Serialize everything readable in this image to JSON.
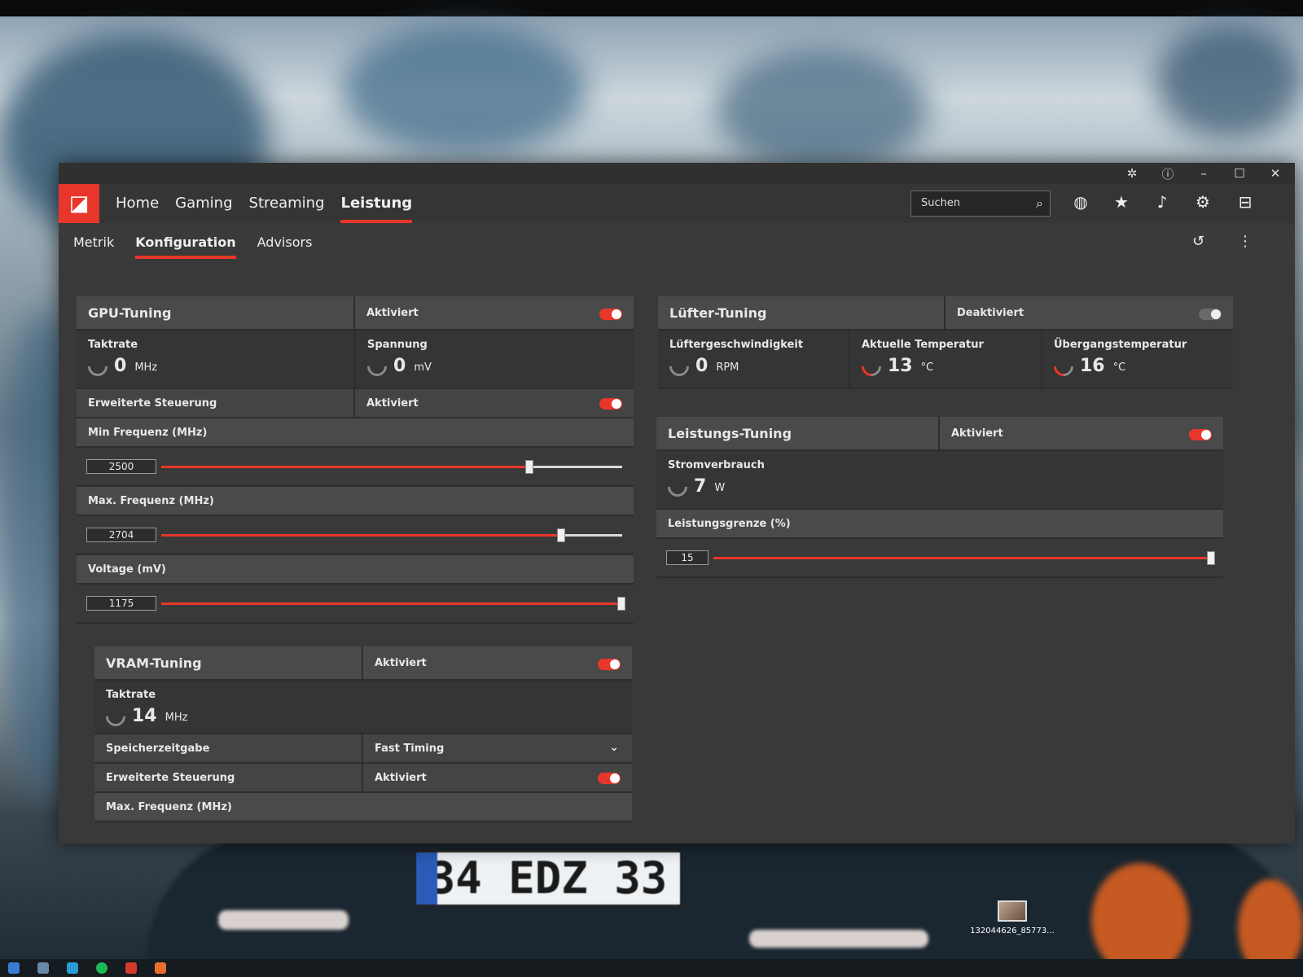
{
  "window": {
    "nav": [
      "Home",
      "Gaming",
      "Streaming",
      "Leistung"
    ],
    "active_nav": "Leistung",
    "search_placeholder": "Suchen",
    "subnav": [
      "Metrik",
      "Konfiguration",
      "Advisors"
    ],
    "active_subnav": "Konfiguration"
  },
  "gpu_tuning": {
    "title": "GPU-Tuning",
    "state": "Aktiviert",
    "enabled": true,
    "taktrate_label": "Taktrate",
    "taktrate_value": "0",
    "taktrate_unit": "MHz",
    "spannung_label": "Spannung",
    "spannung_value": "0",
    "spannung_unit": "mV",
    "erweitert_label": "Erweiterte Steuerung",
    "erweitert_state": "Aktiviert",
    "min_freq_label": "Min Frequenz (MHz)",
    "min_freq_value": "2500",
    "min_freq_fraction": 0.8,
    "max_freq_label": "Max. Frequenz (MHz)",
    "max_freq_value": "2704",
    "max_freq_fraction": 0.87,
    "voltage_label": "Voltage (mV)",
    "voltage_value": "1175",
    "voltage_fraction": 1.0
  },
  "vram_tuning": {
    "title": "VRAM-Tuning",
    "state": "Aktiviert",
    "taktrate_label": "Taktrate",
    "taktrate_value": "14",
    "taktrate_unit": "MHz",
    "timing_label": "Speicherzeitgabe",
    "timing_value": "Fast Timing",
    "erweitert_label": "Erweiterte Steuerung",
    "erweitert_state": "Aktiviert",
    "max_freq_label": "Max. Frequenz (MHz)"
  },
  "fan_tuning": {
    "title": "Lüfter-Tuning",
    "state": "Deaktiviert",
    "speed_label": "Lüftergeschwindigkeit",
    "speed_value": "0",
    "speed_unit": "RPM",
    "temp_label": "Aktuelle Temperatur",
    "temp_value": "13",
    "temp_unit": "°C",
    "junction_label": "Übergangstemperatur",
    "junction_value": "16",
    "junction_unit": "°C"
  },
  "power_tuning": {
    "title": "Leistungs-Tuning",
    "state": "Aktiviert",
    "power_label": "Stromverbrauch",
    "power_value": "7",
    "power_unit": "W",
    "limit_label": "Leistungsgrenze (%)",
    "limit_value": "15",
    "limit_fraction": 1.0
  },
  "desktop": {
    "plate_text": "34 EDZ 33",
    "icon_label": "132044626_85773..."
  },
  "colors": {
    "accent": "#e8372a",
    "panel": "#3b3b3b",
    "header": "#4a4a4a"
  }
}
